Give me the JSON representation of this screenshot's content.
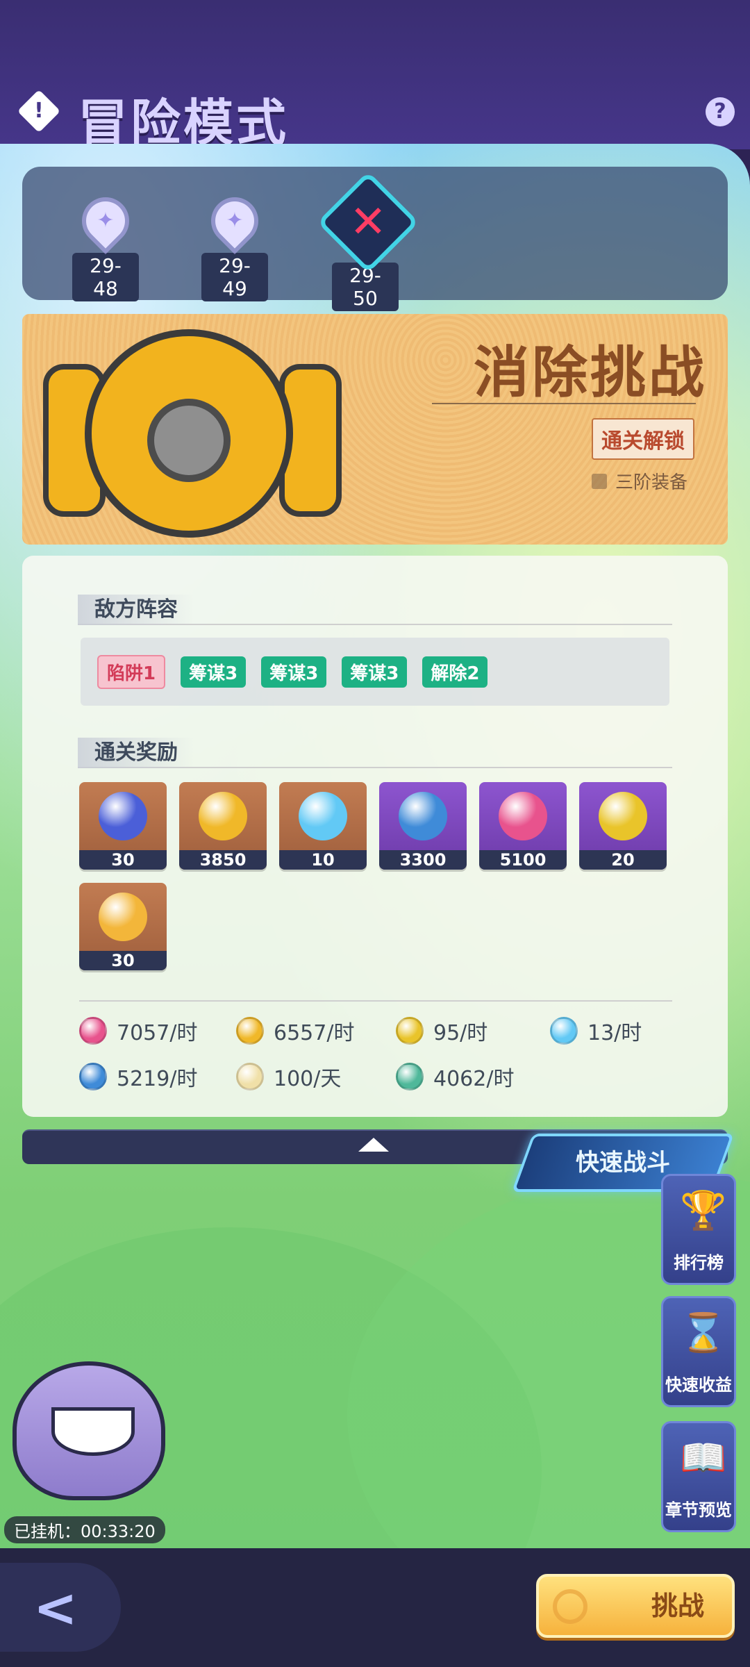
{
  "header": {
    "title": "冒险模式",
    "mode_icon": "!",
    "help_icon": "?"
  },
  "stages": [
    {
      "label": "29-48",
      "state": "cleared"
    },
    {
      "label": "29-49",
      "state": "cleared"
    },
    {
      "label": "29-50",
      "state": "current"
    }
  ],
  "boss_panel": {
    "title": "消除挑战",
    "unlock_badge": "通关解锁",
    "equip_text": "三阶装备"
  },
  "enemy_section": {
    "title": "敌方阵容",
    "traits": [
      {
        "label": "陷阱1",
        "color": "pink"
      },
      {
        "label": "筹谋3",
        "color": "green"
      },
      {
        "label": "筹谋3",
        "color": "green"
      },
      {
        "label": "筹谋3",
        "color": "green"
      },
      {
        "label": "解除2",
        "color": "green"
      }
    ]
  },
  "reward_section": {
    "title": "通关奖励",
    "items": [
      {
        "icon": "puzzle-weapon-icon",
        "amount": "30",
        "bg": "brown",
        "icon_color": "#4b5fd8"
      },
      {
        "icon": "gold-coin-icon",
        "amount": "3850",
        "bg": "brown",
        "icon_color": "#f0b829"
      },
      {
        "icon": "diamond-icon",
        "amount": "10",
        "bg": "brown",
        "icon_color": "#62c9f5"
      },
      {
        "icon": "blue-helmet-icon",
        "amount": "3300",
        "bg": "purple",
        "icon_color": "#3f8bd8"
      },
      {
        "icon": "pink-orb-icon",
        "amount": "5100",
        "bg": "purple",
        "icon_color": "#e8538d"
      },
      {
        "icon": "gold-sword-icon",
        "amount": "20",
        "bg": "purple",
        "icon_color": "#e9c42a"
      },
      {
        "icon": "fire-egg-icon",
        "amount": "30",
        "bg": "brown",
        "icon_color": "#f3b63a"
      }
    ]
  },
  "rates": [
    {
      "icon": "pink-orb-icon",
      "value": "7057/时",
      "color": "#e8538d"
    },
    {
      "icon": "gold-coin-icon",
      "value": "6557/时",
      "color": "#f0b829"
    },
    {
      "icon": "gold-sword-icon",
      "value": "95/时",
      "color": "#e9c42a"
    },
    {
      "icon": "diamond-icon",
      "value": "13/时",
      "color": "#62c9f5"
    },
    {
      "icon": "blue-gem-icon",
      "value": "5219/时",
      "color": "#3f8bd8"
    },
    {
      "icon": "white-star-icon",
      "value": "100/天",
      "color": "#f0e0a8"
    },
    {
      "icon": "green-temple-icon",
      "value": "4062/时",
      "color": "#4fb89a"
    }
  ],
  "quick_battle_label": "快速战斗",
  "side_buttons": [
    {
      "label": "排行榜",
      "glyph": "🏆"
    },
    {
      "label": "快速收益",
      "glyph": "⌛"
    },
    {
      "label": "章节预览",
      "glyph": "📖"
    }
  ],
  "idle_label": "已挂机：00:33:20",
  "bottom": {
    "back_glyph": "<",
    "challenge_label": "挑战"
  },
  "colors": {
    "accent_purple": "#46368a",
    "gold": "#f6b23c",
    "trait_green": "#1db184",
    "trait_pink": "#d33b58"
  }
}
